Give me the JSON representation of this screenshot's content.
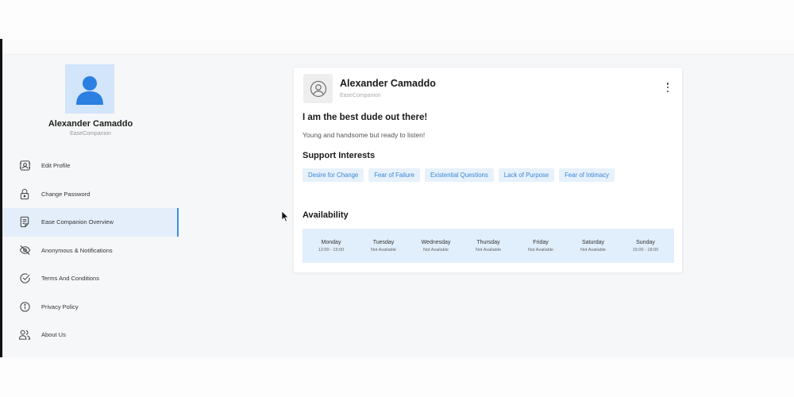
{
  "profile": {
    "name": "Alexander Camaddo",
    "role": "EaseCompanion"
  },
  "sidebar": {
    "items": [
      {
        "label": "Edit Profile",
        "icon": "user-edit-icon"
      },
      {
        "label": "Change Password",
        "icon": "lock-icon"
      },
      {
        "label": "Ease Companion Overview",
        "icon": "document-icon",
        "active": true
      },
      {
        "label": "Anonymous & Notifications",
        "icon": "eye-off-icon"
      },
      {
        "label": "Terms And Conditions",
        "icon": "check-circle-icon"
      },
      {
        "label": "Privacy Policy",
        "icon": "info-icon"
      },
      {
        "label": "About Us",
        "icon": "users-icon"
      }
    ]
  },
  "card": {
    "name": "Alexander Camaddo",
    "role": "EaseCompanion",
    "headline": "I am the best dude out there!",
    "bio": "Young and handsome but ready to listen!",
    "interests_title": "Support Interests",
    "interests": [
      "Desire for Change",
      "Fear of Failure",
      "Existential Questions",
      "Lack of Purpose",
      "Fear of Intimacy"
    ],
    "availability_title": "Availability",
    "availability": [
      {
        "day": "Monday",
        "time": "12:00 - 15:00"
      },
      {
        "day": "Tuesday",
        "time": "Not Available"
      },
      {
        "day": "Wednesday",
        "time": "Not Available"
      },
      {
        "day": "Thursday",
        "time": "Not Available"
      },
      {
        "day": "Friday",
        "time": "Not Available"
      },
      {
        "day": "Saturday",
        "time": "Not Available"
      },
      {
        "day": "Sunday",
        "time": "15:00 - 18:00"
      }
    ]
  },
  "colors": {
    "accent": "#3f8fe0",
    "chip_bg": "#e6f1fb",
    "chip_text": "#3a86d6",
    "active_bg": "#e3eefa",
    "avatar_bg": "#d3e5fb",
    "avatar_fg": "#2b7fe0"
  }
}
